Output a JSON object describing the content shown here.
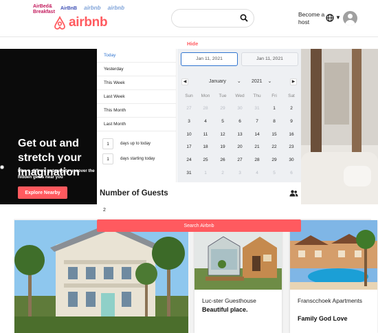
{
  "header": {
    "mini_logos": [
      "AirBed& Breakfast",
      "AirBnB",
      "airbnb",
      "airbnb"
    ],
    "brand": "airbnb",
    "host_label": "Become a host",
    "brand_color": "#ff5a5f"
  },
  "hide_label": "Hide",
  "hero": {
    "title": "Get out and stretch your imagination",
    "subtitle": "Plan a diffrent getaway to uncover the hidden gems near you",
    "button": "Explore Nearby"
  },
  "date_picker": {
    "presets": [
      {
        "label": "Today",
        "active": true
      },
      {
        "label": "Yesterday",
        "active": false
      },
      {
        "label": "This Week",
        "active": false
      },
      {
        "label": "Last Week",
        "active": false
      },
      {
        "label": "This Month",
        "active": false
      },
      {
        "label": "Last Month",
        "active": false
      }
    ],
    "counters": [
      {
        "value": "1",
        "label": "days up to today"
      },
      {
        "value": "1",
        "label": "days starting today"
      }
    ],
    "start_date": "Jan 11, 2021",
    "end_date": "Jan 11, 2021",
    "month": "January",
    "year": "2021",
    "weekdays": [
      "Sun",
      "Mon",
      "Tue",
      "Wed",
      "Thu",
      "Fri",
      "Sat"
    ],
    "weeks": [
      [
        [
          "27",
          1
        ],
        [
          "28",
          1
        ],
        [
          "29",
          1
        ],
        [
          "30",
          1
        ],
        [
          "31",
          1
        ],
        [
          "1",
          0
        ],
        [
          "2",
          0
        ]
      ],
      [
        [
          "3",
          0
        ],
        [
          "4",
          0
        ],
        [
          "5",
          0
        ],
        [
          "6",
          0
        ],
        [
          "7",
          0
        ],
        [
          "8",
          0
        ],
        [
          "9",
          0
        ]
      ],
      [
        [
          "10",
          0
        ],
        [
          "11",
          2
        ],
        [
          "12",
          0
        ],
        [
          "13",
          0
        ],
        [
          "14",
          0
        ],
        [
          "15",
          0
        ],
        [
          "16",
          0
        ]
      ],
      [
        [
          "17",
          0
        ],
        [
          "18",
          0
        ],
        [
          "19",
          0
        ],
        [
          "20",
          0
        ],
        [
          "21",
          0
        ],
        [
          "22",
          0
        ],
        [
          "23",
          0
        ]
      ],
      [
        [
          "24",
          0
        ],
        [
          "25",
          0
        ],
        [
          "26",
          0
        ],
        [
          "27",
          0
        ],
        [
          "28",
          0
        ],
        [
          "29",
          0
        ],
        [
          "30",
          0
        ]
      ],
      [
        [
          "31",
          0
        ],
        [
          "1",
          1
        ],
        [
          "2",
          1
        ],
        [
          "3",
          1
        ],
        [
          "4",
          1
        ],
        [
          "5",
          1
        ],
        [
          "6",
          1
        ]
      ]
    ]
  },
  "guests": {
    "title": "Number of Guests",
    "value": "2",
    "search_button": "Search Airbnb"
  },
  "cards": [
    {
      "name": "Luc-ster Guesthouse",
      "tag": "Beautiful place."
    },
    {
      "name": "Franscchoek Apartments",
      "tag": "Family God Love"
    }
  ]
}
